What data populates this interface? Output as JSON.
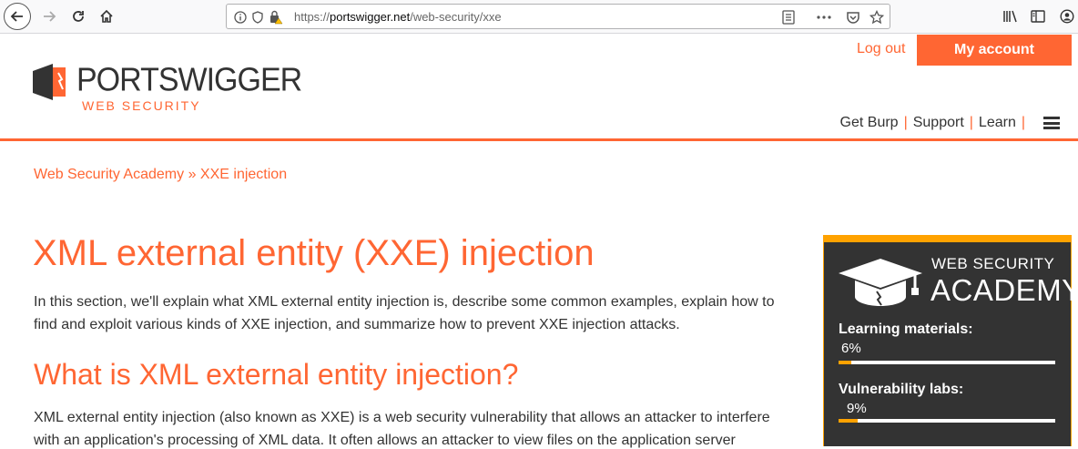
{
  "browser": {
    "url_prefix": "https://",
    "url_domain": "portswigger.net",
    "url_path": "/web-security/xxe"
  },
  "header": {
    "logout": "Log out",
    "my_account": "My account",
    "logo_name": "PORTSWIGGER",
    "logo_sub": "WEB SECURITY",
    "nav": [
      "Get Burp",
      "Support",
      "Learn"
    ]
  },
  "breadcrumb": {
    "root": "Web Security Academy",
    "sep": "»",
    "current": "XXE injection"
  },
  "content": {
    "title": "XML external entity (XXE) injection",
    "intro": "In this section, we'll explain what XML external entity injection is, describe some common examples, explain how to find and exploit various kinds of XXE injection, and summarize how to prevent XXE injection attacks.",
    "h2": "What is XML external entity injection?",
    "p2": "XML external entity injection (also known as XXE) is a web security vulnerability that allows an attacker to interfere with an application's processing of XML data. It often allows an attacker to view files on the application server"
  },
  "academy": {
    "title_small": "WEB SECURITY",
    "title_big": "ACADEMY",
    "learning_label": "Learning materials:",
    "learning_pct": "6%",
    "learning_value": 6,
    "labs_label": "Vulnerability labs:",
    "labs_pct": "9%",
    "labs_value": 9
  },
  "colors": {
    "accent": "#ff6633",
    "progress": "#ffa200",
    "widget_bg": "#333333"
  }
}
